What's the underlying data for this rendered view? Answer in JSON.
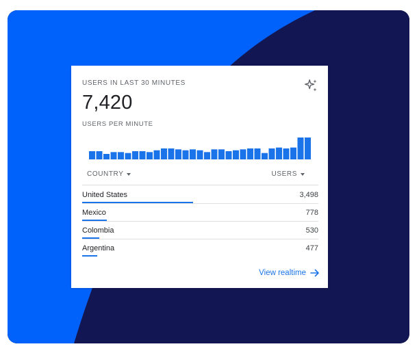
{
  "card": {
    "title": "USERS IN LAST 30 MINUTES",
    "total": "7,420",
    "subtitle": "USERS PER MINUTE",
    "sparkle_icon": "sparkle-icon"
  },
  "chart_data": {
    "type": "bar",
    "values": [
      9,
      9,
      6,
      8,
      8,
      7,
      9,
      9,
      8,
      10,
      12,
      12,
      11,
      10,
      11,
      10,
      8,
      11,
      11,
      9,
      10,
      11,
      12,
      12,
      7,
      12,
      13,
      12,
      13,
      24,
      24
    ],
    "colors": {
      "bar": "#1a73e8"
    }
  },
  "table": {
    "headers": {
      "country": "COUNTRY",
      "users": "USERS"
    },
    "rows": [
      {
        "country": "United States",
        "users": "3,498",
        "share": 0.466
      },
      {
        "country": "Mexico",
        "users": "778",
        "share": 0.104
      },
      {
        "country": "Colombia",
        "users": "530",
        "share": 0.071
      },
      {
        "country": "Argentina",
        "users": "477",
        "share": 0.064
      }
    ]
  },
  "footer": {
    "link_label": "View realtime",
    "link_icon": "arrow-right-icon"
  },
  "colors": {
    "accent": "#1a73e8",
    "bg_blue": "#0061fb",
    "bg_navy": "#121753"
  }
}
